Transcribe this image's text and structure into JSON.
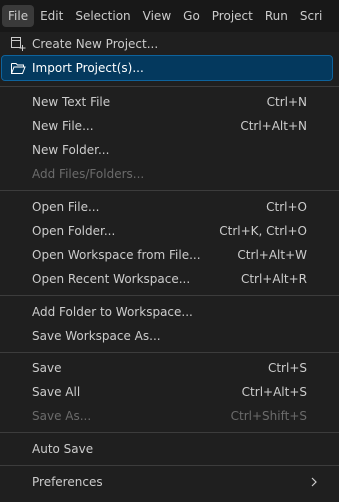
{
  "menubar": {
    "items": [
      "File",
      "Edit",
      "Selection",
      "View",
      "Go",
      "Project",
      "Run",
      "Scri"
    ]
  },
  "menu": {
    "create_new_project": "Create New Project...",
    "import_projects": "Import Project(s)...",
    "new_text_file": {
      "label": "New Text File",
      "key": "Ctrl+N"
    },
    "new_file": {
      "label": "New File...",
      "key": "Ctrl+Alt+N"
    },
    "new_folder": {
      "label": "New Folder..."
    },
    "add_files_folders": {
      "label": "Add Files/Folders..."
    },
    "open_file": {
      "label": "Open File...",
      "key": "Ctrl+O"
    },
    "open_folder": {
      "label": "Open Folder...",
      "key": "Ctrl+K, Ctrl+O"
    },
    "open_workspace": {
      "label": "Open Workspace from File...",
      "key": "Ctrl+Alt+W"
    },
    "open_recent_workspace": {
      "label": "Open Recent Workspace...",
      "key": "Ctrl+Alt+R"
    },
    "add_folder_to_workspace": {
      "label": "Add Folder to Workspace..."
    },
    "save_workspace_as": {
      "label": "Save Workspace As..."
    },
    "save": {
      "label": "Save",
      "key": "Ctrl+S"
    },
    "save_all": {
      "label": "Save All",
      "key": "Ctrl+Alt+S"
    },
    "save_as": {
      "label": "Save As...",
      "key": "Ctrl+Shift+S"
    },
    "auto_save": {
      "label": "Auto Save"
    },
    "preferences": {
      "label": "Preferences"
    }
  },
  "icons": {
    "create_new_project": "new-project-icon",
    "import_projects": "folder-open-icon",
    "preferences_submenu": "chevron-right-icon"
  },
  "colors": {
    "highlight_bg": "#04395e",
    "highlight_border": "#0e639c",
    "menu_bg": "#1f1f1f",
    "text": "#cccccc",
    "disabled_text": "#6b6b6b"
  }
}
